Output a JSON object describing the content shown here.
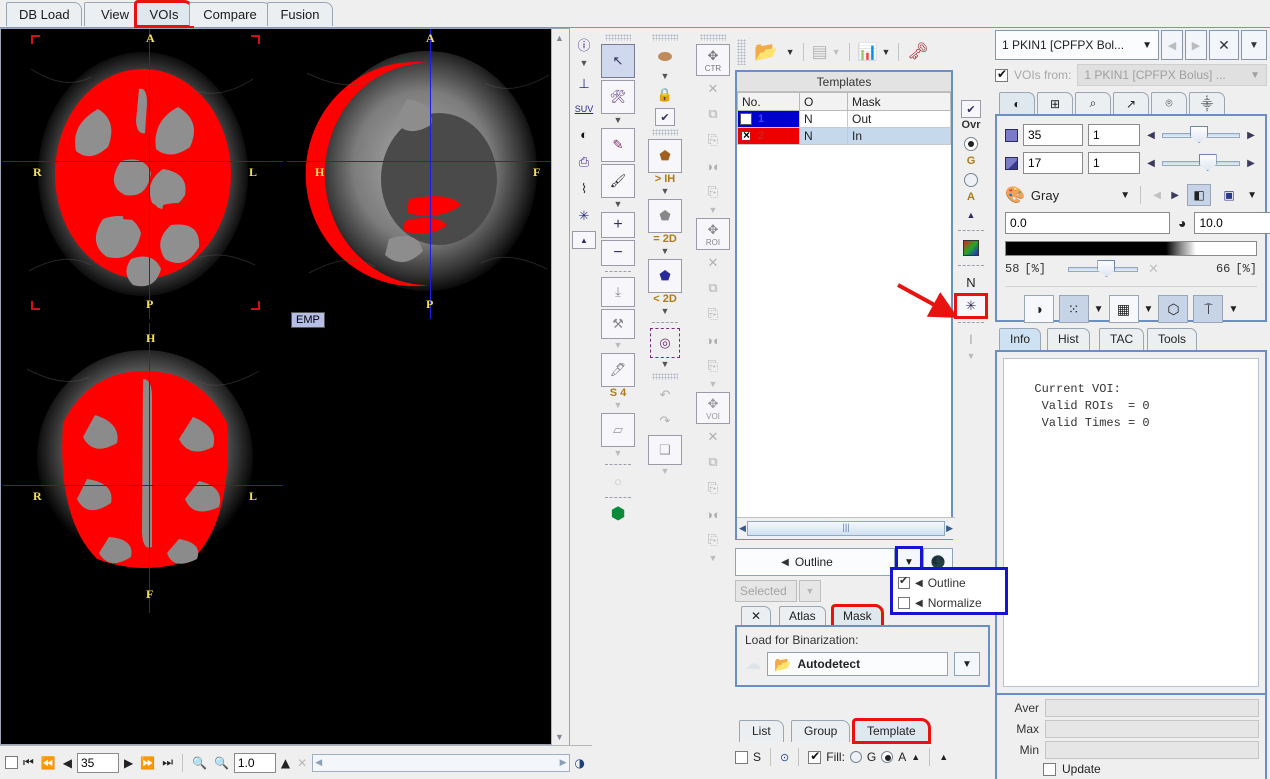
{
  "app": {
    "main_tabs": [
      {
        "label": "DB Load",
        "selected": false
      },
      {
        "label": "View",
        "selected": false
      },
      {
        "label": "VOIs",
        "selected": true,
        "highlight": "red"
      },
      {
        "label": "Compare",
        "selected": false
      },
      {
        "label": "Fusion",
        "selected": false
      }
    ]
  },
  "images": {
    "transverse": {
      "orient_top": "A",
      "orient_bottom": "P",
      "orient_left": "R",
      "orient_right": "L"
    },
    "sagittal": {
      "orient_top": "A",
      "orient_bottom": "P",
      "orient_left": "H",
      "orient_right": "F"
    },
    "coronal": {
      "orient_top": "H",
      "orient_bottom": "F",
      "orient_left": "R",
      "orient_right": "L"
    },
    "emp_button": "EMP",
    "overlay_color": "#ff0000",
    "crosshair_color": "#1d1de8"
  },
  "image_controls": {
    "checkbox_checked": false,
    "slice_value": "35",
    "zoom_value": "1.0",
    "first_icon": "first-slice-icon",
    "prev_fast_icon": "prev-fast-icon",
    "prev_icon": "prev-slice-icon",
    "next_icon": "next-slice-icon",
    "next_fast_icon": "next-fast-icon",
    "last_icon": "last-slice-icon",
    "zoom_in_icon": "zoom-in-icon",
    "zoom_out_icon": "zoom-out-icon"
  },
  "left_toolbar": [
    {
      "name": "info-icon",
      "glyph": "ⓘ"
    },
    {
      "name": "caret-down-icon",
      "glyph": "▼"
    },
    {
      "name": "reorient-icon",
      "glyph": "╁"
    },
    {
      "name": "suv-icon",
      "glyph": "SUV"
    },
    {
      "name": "contrast-icon",
      "glyph": "◐"
    },
    {
      "name": "printer-icon",
      "glyph": "⎙"
    },
    {
      "name": "thermometer-icon",
      "glyph": "☡"
    },
    {
      "name": "target-icon",
      "glyph": "✣"
    },
    {
      "name": "collapse-icon",
      "glyph": "▲"
    }
  ],
  "vois_toolbar": [
    {
      "name": "pointer-tool",
      "glyph": "↖",
      "active": true,
      "caption": ""
    },
    {
      "name": "wrench-tool",
      "glyph": "⚒",
      "active": false,
      "caption": ""
    },
    {
      "name": "caret-down-icon",
      "glyph": "▼",
      "active": false,
      "caption": ""
    },
    {
      "name": "scalpel-tool",
      "glyph": "✐",
      "active": false,
      "caption": ""
    },
    {
      "name": "brush-tool",
      "glyph": "⎙",
      "active": false,
      "caption": ""
    },
    {
      "name": "caret-down-icon",
      "glyph": "▼",
      "active": false,
      "caption": ""
    },
    {
      "name": "plus-tool",
      "glyph": "+",
      "active": false,
      "caption": ""
    },
    {
      "name": "minus-tool",
      "glyph": "−",
      "active": false,
      "caption": ""
    },
    {
      "name": "shrink-tool",
      "glyph": "⤓",
      "active": false,
      "caption": ""
    },
    {
      "name": "axe-tool",
      "glyph": "⚒",
      "active": false,
      "caption": ""
    },
    {
      "name": "caret-down-icon",
      "glyph": "▼",
      "active": false,
      "caption": ""
    },
    {
      "name": "paint-tool",
      "glyph": "✎",
      "active": false,
      "caption": "S 4"
    },
    {
      "name": "caret-down-icon",
      "glyph": "▼",
      "active": false,
      "caption": ""
    },
    {
      "name": "eraser-3d-tool",
      "glyph": "⬚",
      "active": false,
      "caption": ""
    },
    {
      "name": "caret-down-icon",
      "glyph": "▼",
      "active": false,
      "caption": ""
    },
    {
      "name": "circle-tool",
      "glyph": "○",
      "active": false,
      "caption": ""
    },
    {
      "name": "green-accept-icon",
      "glyph": "▼",
      "active": false,
      "caption": ""
    }
  ],
  "segmentation_toolbar": [
    {
      "name": "skull-icon",
      "glyph": "◉",
      "caption": ""
    },
    {
      "name": "caret-down-icon",
      "glyph": "▼",
      "caption": ""
    },
    {
      "name": "lock-icon",
      "glyph": "ὑ2",
      "caption": ""
    },
    {
      "name": "check-icon",
      "glyph": "✔",
      "caption": ""
    },
    {
      "name": "paint-bucket-gt-icon",
      "glyph": "⬟",
      "caption": "> IH"
    },
    {
      "name": "caret-down-icon",
      "glyph": "▼",
      "caption": ""
    },
    {
      "name": "paint-bucket-eq-icon",
      "glyph": "⬟",
      "caption": "= 2D"
    },
    {
      "name": "caret-down-icon",
      "glyph": "▼",
      "caption": ""
    },
    {
      "name": "paint-bucket-lt-icon",
      "glyph": "⬟",
      "caption": "< 2D"
    },
    {
      "name": "caret-down-icon",
      "glyph": "▼",
      "caption": ""
    },
    {
      "name": "selection-marquee-icon",
      "glyph": "◎",
      "caption": ""
    },
    {
      "name": "caret-down-icon",
      "glyph": "▼",
      "caption": ""
    },
    {
      "name": "undo-icon",
      "glyph": "↶",
      "caption": ""
    },
    {
      "name": "redo-icon",
      "glyph": "↷",
      "caption": ""
    },
    {
      "name": "box-icon",
      "glyph": "❐",
      "caption": ""
    }
  ],
  "transform_toolbar": [
    {
      "name": "move-ctr-icon",
      "glyph": "✥",
      "caption": "CTR",
      "framed": true
    },
    {
      "name": "delete-icon",
      "glyph": "✕",
      "caption": "",
      "framed": false
    },
    {
      "name": "copy-icon",
      "glyph": "⧉",
      "caption": "",
      "framed": false
    },
    {
      "name": "paste-icon",
      "glyph": "⎘",
      "caption": "",
      "framed": false
    },
    {
      "name": "mirror-icon",
      "glyph": "◐◑",
      "caption": "",
      "framed": false
    },
    {
      "name": "add-copy-icon",
      "glyph": "⎘",
      "caption": "",
      "framed": false
    },
    {
      "name": "caret-down-icon",
      "glyph": "▼",
      "caption": "",
      "framed": false
    },
    {
      "name": "move-roi-icon",
      "glyph": "✥",
      "caption": "ROI",
      "framed": true
    },
    {
      "name": "delete-icon",
      "glyph": "✕",
      "caption": "",
      "framed": false
    },
    {
      "name": "copy-icon",
      "glyph": "⧉",
      "caption": "",
      "framed": false
    },
    {
      "name": "paste-icon",
      "glyph": "⎘",
      "caption": "",
      "framed": false
    },
    {
      "name": "mirror-icon",
      "glyph": "◐◑",
      "caption": "",
      "framed": false
    },
    {
      "name": "add-copy-icon",
      "glyph": "⎘",
      "caption": "",
      "framed": false
    },
    {
      "name": "caret-down-icon",
      "glyph": "▼",
      "caption": "",
      "framed": false
    },
    {
      "name": "move-voi-icon",
      "glyph": "✥",
      "caption": "VOI",
      "framed": true
    },
    {
      "name": "delete-icon",
      "glyph": "✕",
      "caption": "",
      "framed": false
    },
    {
      "name": "copy-icon",
      "glyph": "⧉",
      "caption": "",
      "framed": false
    },
    {
      "name": "paste-icon",
      "glyph": "⎘",
      "caption": "",
      "framed": false
    },
    {
      "name": "mirror-icon",
      "glyph": "◐◑",
      "caption": "",
      "framed": false
    },
    {
      "name": "add-copy-icon",
      "glyph": "⎘",
      "caption": "",
      "framed": false
    },
    {
      "name": "caret-down-icon",
      "glyph": "▼",
      "caption": "",
      "framed": false
    }
  ],
  "display_toolbar": [
    {
      "name": "overlay-checkbox",
      "glyph": "✔",
      "caption": "Ovr",
      "type": "check"
    },
    {
      "name": "gray-radio",
      "glyph": "",
      "caption": "G",
      "type": "radio-on"
    },
    {
      "name": "all-radio",
      "glyph": "",
      "caption": "A",
      "type": "radio-off"
    },
    {
      "name": "collapse-icon",
      "glyph": "▲",
      "caption": "",
      "type": "plain"
    },
    {
      "name": "color-palette-icon",
      "glyph": "▒",
      "caption": "",
      "type": "plain"
    },
    {
      "name": "names-toggle",
      "glyph": "N",
      "caption": "",
      "type": "plain"
    },
    {
      "name": "star-marker-toggle",
      "glyph": "✳",
      "caption": "",
      "type": "plain",
      "highlight": "red"
    },
    {
      "name": "text-cursor-icon",
      "glyph": "I",
      "caption": "",
      "type": "plain"
    },
    {
      "name": "caret-down-icon",
      "glyph": "▼",
      "caption": "",
      "type": "plain"
    }
  ],
  "top_toolbar": {
    "open_icon": "open-folder-icon",
    "save_icon": "save-icon",
    "chart_icon": "histogram-icon",
    "convert_icon": "convert-icon",
    "caret_icon": "caret-down-icon"
  },
  "templates": {
    "title": "Templates",
    "columns": [
      "No.",
      "O",
      "Mask"
    ],
    "rows": [
      {
        "no": "1",
        "o": "N",
        "mask": "Out",
        "color": "#0000cc",
        "checked": false
      },
      {
        "no": "2",
        "o": "N",
        "mask": "In",
        "color": "#ee0000",
        "checked": true
      }
    ],
    "outline_field": "Outline",
    "outline_arrow": "◀",
    "dropdown_menu": [
      {
        "label": "Outline",
        "checked": true
      },
      {
        "label": "Normalize",
        "checked": false
      }
    ],
    "selected_combo": "Selected",
    "sub_tabs": [
      {
        "label": "✕",
        "selected": false,
        "name": "tab-close"
      },
      {
        "label": "Atlas",
        "selected": false,
        "name": "tab-atlas"
      },
      {
        "label": "Mask",
        "selected": true,
        "name": "tab-mask",
        "highlight": "red"
      }
    ],
    "binarization_label": "Load for Binarization:",
    "autodetect_label": "Autodetect",
    "bottom_tabs": [
      {
        "label": "List",
        "selected": false
      },
      {
        "label": "Group",
        "selected": false
      },
      {
        "label": "Template",
        "selected": true,
        "highlight": "red"
      }
    ],
    "bottom_controls": {
      "s_checkbox": "S",
      "s_checked": false,
      "fill_label": "Fill:",
      "fill_checked": true,
      "fill_g": "G",
      "fill_g_on": false,
      "fill_a": "A",
      "fill_a_on": true
    }
  },
  "right": {
    "series_title": "1 PKIN1 [CPFPX Bol...",
    "vois_from_label": "VOIs from:",
    "vois_from_value": "1 PKIN1 [CPFPX Bolus] ...",
    "vois_from_checked": true,
    "icon_tabs": [
      {
        "name": "tab-contrast",
        "glyph": "◐",
        "selected": true
      },
      {
        "name": "tab-layout",
        "glyph": "⊞",
        "selected": false
      },
      {
        "name": "tab-pointer",
        "glyph": "⌕",
        "selected": false
      },
      {
        "name": "tab-curve",
        "glyph": "↗",
        "selected": false
      },
      {
        "name": "tab-brain",
        "glyph": "⌾",
        "selected": false
      },
      {
        "name": "tab-probe",
        "glyph": "⸎",
        "selected": false
      }
    ],
    "slice_value": "35",
    "slice_step": "1",
    "slice_slider_pct": 36,
    "frame_value": "17",
    "frame_step": "1",
    "frame_slider_pct": 47,
    "palette_name": "Gray",
    "range_min": "0.0",
    "range_max": "10.0",
    "pct_low": "58",
    "pct_low_unit": "[%]",
    "pct_high": "66",
    "pct_high_unit": "[%]",
    "pct_slider_pct": 42,
    "display_buttons": [
      {
        "name": "checker-display-button",
        "glyph": "◑",
        "on": false
      },
      {
        "name": "markers-display-button",
        "glyph": "⁙",
        "on": true
      },
      {
        "name": "grid-display-button",
        "glyph": "▒",
        "on": false
      },
      {
        "name": "outline-display-button",
        "glyph": "⬡",
        "on": true
      },
      {
        "name": "text-display-button",
        "glyph": "Ⓣ",
        "on": true
      }
    ],
    "info_tabs": [
      {
        "label": "Info",
        "selected": true
      },
      {
        "label": "Hist",
        "selected": false
      },
      {
        "label": "TAC",
        "selected": false
      },
      {
        "label": "Tools",
        "selected": false
      }
    ],
    "info_text": "  Current VOI:\n   Valid ROIs  = 0\n   Valid Times = 0",
    "stats": [
      {
        "label": "Aver",
        "value": ""
      },
      {
        "label": "Max",
        "value": ""
      },
      {
        "label": "Min",
        "value": ""
      }
    ],
    "update_label": "Update",
    "update_checked": false
  },
  "annotations": {
    "arrow_color": "#e8130f",
    "highlight_red": "#e8130f",
    "highlight_blue": "#1414d2"
  }
}
